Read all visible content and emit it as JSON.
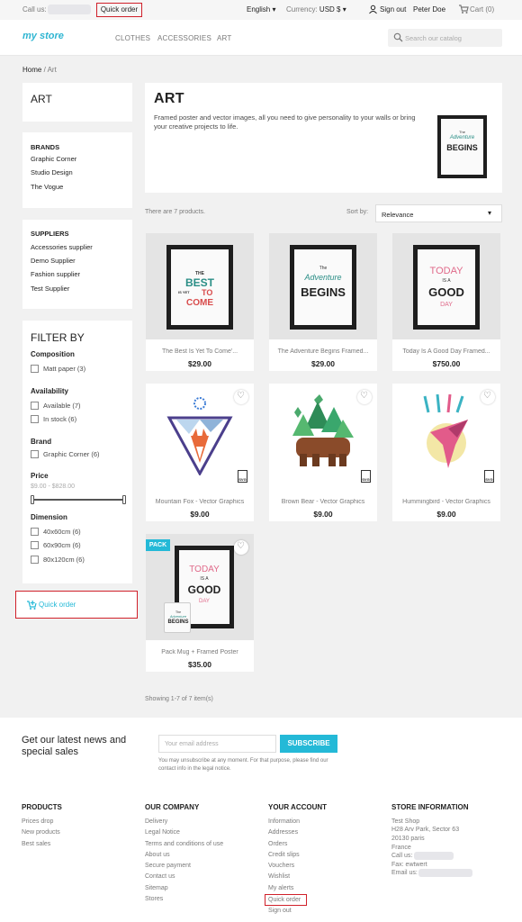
{
  "topbar": {
    "call_us": "Call us:",
    "quick_order": "Quick order",
    "language": "English",
    "currency_label": "Currency:",
    "currency_value": "USD $",
    "sign_out": "Sign out",
    "user_name": "Peter Doe",
    "cart_label": "Cart",
    "cart_count": "(0)"
  },
  "header": {
    "logo": "my store",
    "nav": [
      "CLOTHES",
      "ACCESSORIES",
      "ART"
    ],
    "search_placeholder": "Search our catalog"
  },
  "breadcrumb": {
    "home": "Home",
    "sep": "/",
    "current": "Art"
  },
  "sidebar": {
    "category_title": "ART",
    "brands_title": "BRANDS",
    "brands": [
      "Graphic Corner",
      "Studio Design",
      "The Vogue"
    ],
    "suppliers_title": "SUPPLIERS",
    "suppliers": [
      "Accessories supplier",
      "Demo Supplier",
      "Fashion supplier",
      "Test Supplier"
    ],
    "filter_title": "FILTER BY",
    "composition_title": "Composition",
    "composition": "Matt paper (3)",
    "availability_title": "Availability",
    "availability": [
      "Available (7)",
      "In stock (6)"
    ],
    "brand_title": "Brand",
    "brand": "Graphic Corner (6)",
    "price_title": "Price",
    "price_range": "$9.00 - $828.00",
    "dimension_title": "Dimension",
    "dimensions": [
      "40x60cm (6)",
      "60x90cm (6)",
      "80x120cm (6)"
    ],
    "quick_order": "Quick order"
  },
  "category": {
    "title": "ART",
    "description": "Framed poster and vector images, all you need to give personality to your walls or bring your creative projects to life.",
    "thumb_text_1": "The",
    "thumb_text_2": "Adventure",
    "thumb_text_3": "BEGINS"
  },
  "listing": {
    "count_text": "There are 7 products.",
    "sort_label": "Sort by:",
    "sort_value": "Relevance",
    "showing": "Showing 1-7 of 7 item(s)"
  },
  "products": [
    {
      "name": "The Best Is Yet To Come'...",
      "price": "$29.00",
      "poster": [
        "THE",
        "BEST",
        "IS YET",
        "TO",
        "COME"
      ]
    },
    {
      "name": "The Adventure Begins Framed...",
      "price": "$29.00",
      "poster": [
        "The",
        "Adventure",
        "BEGINS"
      ]
    },
    {
      "name": "Today Is A Good Day Framed...",
      "price": "$750.00",
      "poster": [
        "TODAY",
        "IS A",
        "GOOD",
        "DAY"
      ]
    },
    {
      "name": "Mountain Fox - Vector Graphics",
      "price": "$9.00",
      "badge": "SVG"
    },
    {
      "name": "Brown Bear - Vector Graphics",
      "price": "$9.00",
      "badge": "SVG"
    },
    {
      "name": "Hummingbird - Vector Graphics",
      "price": "$9.00",
      "badge": "SVG"
    },
    {
      "name": "Pack Mug + Framed Poster",
      "price": "$35.00",
      "flag": "PACK",
      "poster": [
        "TODAY",
        "IS A",
        "GOOD",
        "DAY"
      ],
      "mug": [
        "The",
        "Adventure",
        "BEGINS"
      ]
    }
  ],
  "newsletter": {
    "title": "Get our latest news and special sales",
    "placeholder": "Your email address",
    "button": "SUBSCRIBE",
    "note": "You may unsubscribe at any moment. For that purpose, please find our contact info in the legal notice."
  },
  "footer": {
    "products_title": "PRODUCTS",
    "products": [
      "Prices drop",
      "New products",
      "Best sales"
    ],
    "company_title": "OUR COMPANY",
    "company": [
      "Delivery",
      "Legal Notice",
      "Terms and conditions of use",
      "About us",
      "Secure payment",
      "Contact us",
      "Sitemap",
      "Stores"
    ],
    "account_title": "YOUR ACCOUNT",
    "account": [
      "Information",
      "Addresses",
      "Orders",
      "Credit slips",
      "Vouchers",
      "Wishlist",
      "My alerts",
      "Quick order",
      "Sign out"
    ],
    "store_title": "STORE INFORMATION",
    "store": [
      "Test Shop",
      "H28 Arv Park, Sector 63",
      "20130 paris",
      "France"
    ],
    "call_us": "Call us:",
    "fax": "Fax: ewtwert",
    "email": "Email us:"
  },
  "colors": {
    "accent": "#24b9d7",
    "highlight": "#d0202a"
  }
}
